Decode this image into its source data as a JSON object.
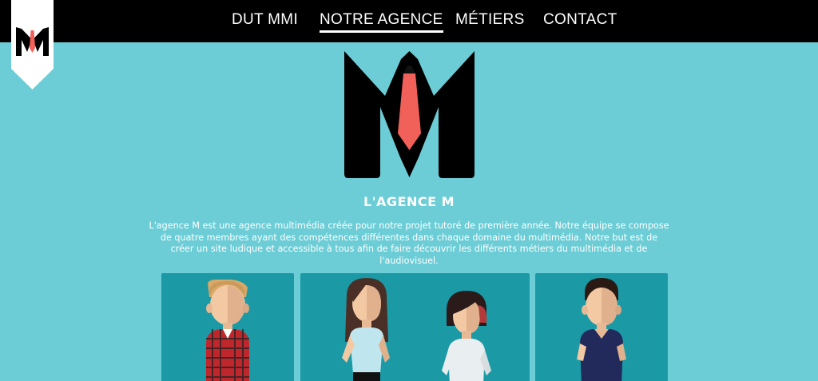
{
  "nav": {
    "items": [
      "DUT MMI",
      "NOTRE AGENCE",
      "MÉTIERS",
      "CONTACT"
    ],
    "active_index": 1
  },
  "agency": {
    "title": "L'AGENCE M",
    "description": "L'agence M est une agence multimédia créée pour notre projet tutoré de première année. Notre équipe se compose de quatre membres ayant des compétences différentes dans chaque domaine du multimédia. Notre but est de créer un site ludique et accessible à tous afin de faire découvrir les différents métiers du multimédia et de l'audiovisuel."
  },
  "colors": {
    "background": "#6ccdd6",
    "navbar": "#000000",
    "card": "#1b9aa6",
    "tie": "#f2605a",
    "text": "#ffffff"
  },
  "team": [
    "boy-plaid-shirt-avatar",
    "girl-long-hair-avatar",
    "girl-short-hair-avatar",
    "boy-navy-polo-avatar"
  ]
}
